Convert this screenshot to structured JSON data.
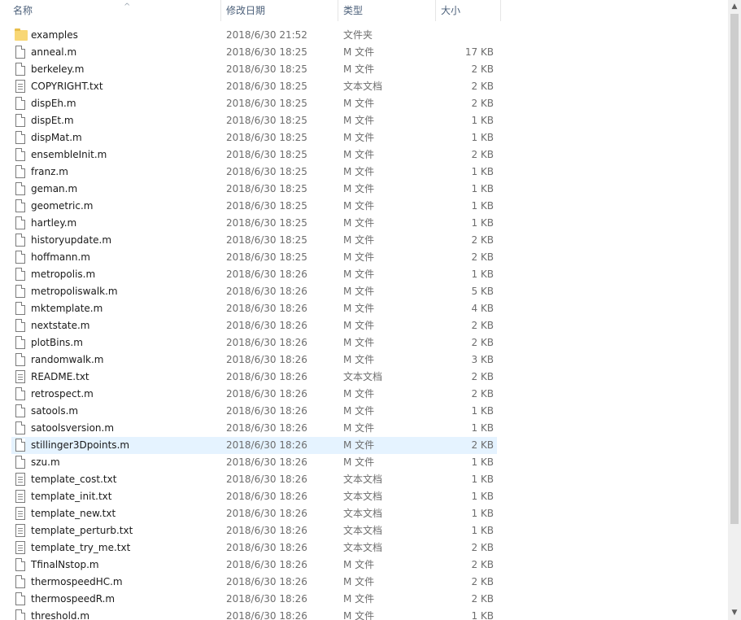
{
  "header": {
    "name": "名称",
    "date": "修改日期",
    "type": "类型",
    "size": "大小",
    "sort_indicator": "^"
  },
  "icons": {
    "folder": "folder-icon",
    "file": "file-icon",
    "text": "text-document-icon"
  },
  "scrollbar": {
    "up": "▲",
    "down": "▼"
  },
  "files": [
    {
      "name": "examples",
      "date": "2018/6/30 21:52",
      "type": "文件夹",
      "size": "",
      "icon": "folder"
    },
    {
      "name": "anneal.m",
      "date": "2018/6/30 18:25",
      "type": "M 文件",
      "size": "17 KB",
      "icon": "file"
    },
    {
      "name": "berkeley.m",
      "date": "2018/6/30 18:25",
      "type": "M 文件",
      "size": "2 KB",
      "icon": "file"
    },
    {
      "name": "COPYRIGHT.txt",
      "date": "2018/6/30 18:25",
      "type": "文本文档",
      "size": "2 KB",
      "icon": "text"
    },
    {
      "name": "dispEh.m",
      "date": "2018/6/30 18:25",
      "type": "M 文件",
      "size": "2 KB",
      "icon": "file"
    },
    {
      "name": "dispEt.m",
      "date": "2018/6/30 18:25",
      "type": "M 文件",
      "size": "1 KB",
      "icon": "file"
    },
    {
      "name": "dispMat.m",
      "date": "2018/6/30 18:25",
      "type": "M 文件",
      "size": "1 KB",
      "icon": "file"
    },
    {
      "name": "ensembleInit.m",
      "date": "2018/6/30 18:25",
      "type": "M 文件",
      "size": "2 KB",
      "icon": "file"
    },
    {
      "name": "franz.m",
      "date": "2018/6/30 18:25",
      "type": "M 文件",
      "size": "1 KB",
      "icon": "file"
    },
    {
      "name": "geman.m",
      "date": "2018/6/30 18:25",
      "type": "M 文件",
      "size": "1 KB",
      "icon": "file"
    },
    {
      "name": "geometric.m",
      "date": "2018/6/30 18:25",
      "type": "M 文件",
      "size": "1 KB",
      "icon": "file"
    },
    {
      "name": "hartley.m",
      "date": "2018/6/30 18:25",
      "type": "M 文件",
      "size": "1 KB",
      "icon": "file"
    },
    {
      "name": "historyupdate.m",
      "date": "2018/6/30 18:25",
      "type": "M 文件",
      "size": "2 KB",
      "icon": "file"
    },
    {
      "name": "hoffmann.m",
      "date": "2018/6/30 18:25",
      "type": "M 文件",
      "size": "2 KB",
      "icon": "file"
    },
    {
      "name": "metropolis.m",
      "date": "2018/6/30 18:26",
      "type": "M 文件",
      "size": "1 KB",
      "icon": "file"
    },
    {
      "name": "metropoliswalk.m",
      "date": "2018/6/30 18:26",
      "type": "M 文件",
      "size": "5 KB",
      "icon": "file"
    },
    {
      "name": "mktemplate.m",
      "date": "2018/6/30 18:26",
      "type": "M 文件",
      "size": "4 KB",
      "icon": "file"
    },
    {
      "name": "nextstate.m",
      "date": "2018/6/30 18:26",
      "type": "M 文件",
      "size": "2 KB",
      "icon": "file"
    },
    {
      "name": "plotBins.m",
      "date": "2018/6/30 18:26",
      "type": "M 文件",
      "size": "2 KB",
      "icon": "file"
    },
    {
      "name": "randomwalk.m",
      "date": "2018/6/30 18:26",
      "type": "M 文件",
      "size": "3 KB",
      "icon": "file"
    },
    {
      "name": "README.txt",
      "date": "2018/6/30 18:26",
      "type": "文本文档",
      "size": "2 KB",
      "icon": "text"
    },
    {
      "name": "retrospect.m",
      "date": "2018/6/30 18:26",
      "type": "M 文件",
      "size": "2 KB",
      "icon": "file"
    },
    {
      "name": "satools.m",
      "date": "2018/6/30 18:26",
      "type": "M 文件",
      "size": "1 KB",
      "icon": "file"
    },
    {
      "name": "satoolsversion.m",
      "date": "2018/6/30 18:26",
      "type": "M 文件",
      "size": "1 KB",
      "icon": "file"
    },
    {
      "name": "stillinger3Dpoints.m",
      "date": "2018/6/30 18:26",
      "type": "M 文件",
      "size": "2 KB",
      "icon": "file",
      "selected": true
    },
    {
      "name": "szu.m",
      "date": "2018/6/30 18:26",
      "type": "M 文件",
      "size": "1 KB",
      "icon": "file"
    },
    {
      "name": "template_cost.txt",
      "date": "2018/6/30 18:26",
      "type": "文本文档",
      "size": "1 KB",
      "icon": "text"
    },
    {
      "name": "template_init.txt",
      "date": "2018/6/30 18:26",
      "type": "文本文档",
      "size": "1 KB",
      "icon": "text"
    },
    {
      "name": "template_new.txt",
      "date": "2018/6/30 18:26",
      "type": "文本文档",
      "size": "1 KB",
      "icon": "text"
    },
    {
      "name": "template_perturb.txt",
      "date": "2018/6/30 18:26",
      "type": "文本文档",
      "size": "1 KB",
      "icon": "text"
    },
    {
      "name": "template_try_me.txt",
      "date": "2018/6/30 18:26",
      "type": "文本文档",
      "size": "2 KB",
      "icon": "text"
    },
    {
      "name": "TfinalNstop.m",
      "date": "2018/6/30 18:26",
      "type": "M 文件",
      "size": "2 KB",
      "icon": "file"
    },
    {
      "name": "thermospeedHC.m",
      "date": "2018/6/30 18:26",
      "type": "M 文件",
      "size": "2 KB",
      "icon": "file"
    },
    {
      "name": "thermospeedR.m",
      "date": "2018/6/30 18:26",
      "type": "M 文件",
      "size": "2 KB",
      "icon": "file"
    },
    {
      "name": "threshold.m",
      "date": "2018/6/30 18:26",
      "type": "M 文件",
      "size": "1 KB",
      "icon": "file"
    }
  ]
}
